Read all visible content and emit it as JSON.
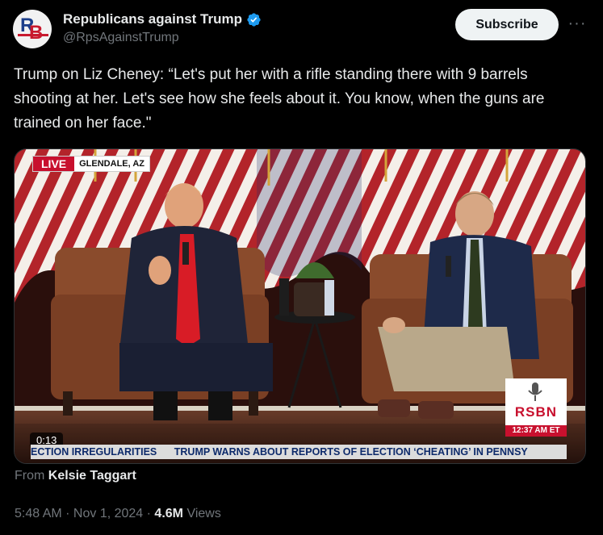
{
  "author": {
    "display_name": "Republicans against Trump",
    "handle": "@RpsAgainstTrump",
    "verified": true,
    "avatar_letters": "RB"
  },
  "subscribe_label": "Subscribe",
  "more_label": "···",
  "tweet_text": "Trump on Liz Cheney: “Let's put her with a rifle standing there with 9 barrels shooting at her. Let's see how she feels about it. You know, when the guns are trained on her face.\"",
  "video": {
    "live_label": "LIVE",
    "location": "GLENDALE, AZ",
    "duration": "0:13",
    "ticker_left": "ECTION IRREGULARITIES",
    "ticker_right": "TRUMP WARNS ABOUT REPORTS OF ELECTION ‘CHEATING’ IN PENNSY",
    "network": "RSBN",
    "network_time": "12:37 AM ET"
  },
  "source": {
    "prefix": "From",
    "name": "Kelsie Taggart"
  },
  "meta": {
    "time": "5:48 AM",
    "sep": " · ",
    "date": "Nov 1, 2024",
    "views_count": "4.6M",
    "views_label": "Views"
  },
  "colors": {
    "accent_verified": "#1d9bf0",
    "background": "#000000",
    "text_primary": "#e7e9ea",
    "text_secondary": "#71767b"
  }
}
